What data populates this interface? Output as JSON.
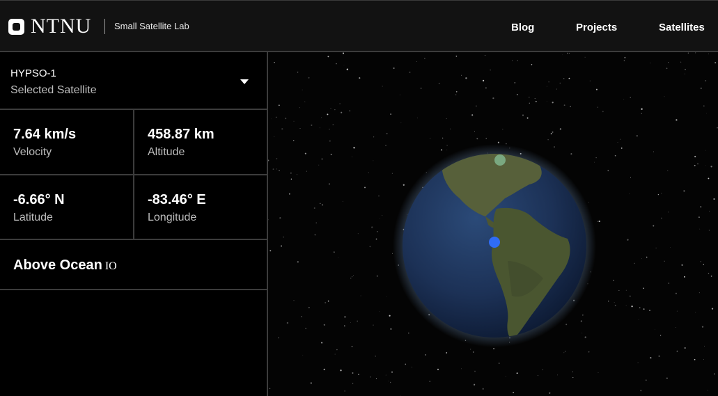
{
  "header": {
    "logo_text": "NTNU",
    "logo_subtitle": "Small Satellite Lab",
    "nav": [
      {
        "label": "Blog"
      },
      {
        "label": "Projects"
      },
      {
        "label": "Satellites"
      }
    ]
  },
  "sidebar": {
    "selected_satellite": "HYPSO-1",
    "selected_label": "Selected Satellite",
    "stats": [
      {
        "value": "7.64 km/s",
        "label": "Velocity"
      },
      {
        "value": "458.87 km",
        "label": "Altitude"
      },
      {
        "value": "-6.66° N",
        "label": "Latitude"
      },
      {
        "value": "-83.46° E",
        "label": "Longitude"
      }
    ],
    "location_status": "Above Ocean",
    "location_suffix": "IO"
  },
  "colors": {
    "satellite_marker": "#2f6cf6",
    "ground_station_marker": "#7aa880",
    "globe_ocean": "#1e3358",
    "globe_land": "#4a5630"
  },
  "icons": {
    "logo": "ntnu-logo-icon",
    "dropdown": "caret-down-icon"
  }
}
